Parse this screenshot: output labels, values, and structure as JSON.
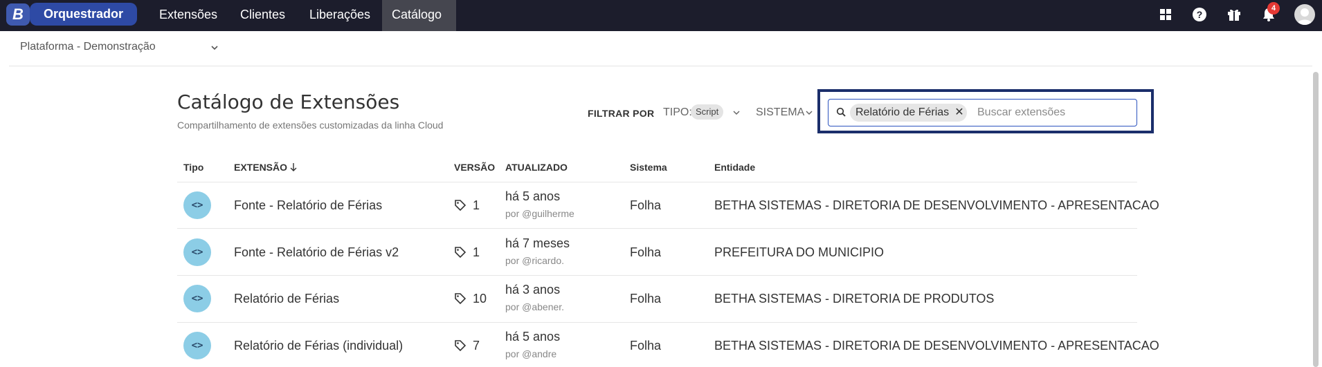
{
  "topbar": {
    "logo": "B",
    "app_name": "Orquestrador",
    "nav": [
      "Extensões",
      "Clientes",
      "Liberações",
      "Catálogo"
    ],
    "active_nav": "Catálogo",
    "notification_count": "4",
    "icons": [
      "apps-grid-icon",
      "help-icon",
      "gift-icon",
      "bell-icon",
      "avatar"
    ]
  },
  "platform": {
    "label": "Plataforma - Demonstração"
  },
  "header": {
    "title": "Catálogo de Extensões",
    "subtitle": "Compartilhamento de extensões customizadas da linha Cloud"
  },
  "filters": {
    "label": "FILTRAR POR",
    "tipo_label": "TIPO:",
    "tipo_value": "Script",
    "sistema_label": "SISTEMA",
    "search_chip": "Relatório de Férias",
    "search_placeholder": "Buscar extensões"
  },
  "table": {
    "columns": [
      "Tipo",
      "EXTENSÃO",
      "VERSÃO",
      "ATUALIZADO",
      "Sistema",
      "Entidade"
    ],
    "rows": [
      {
        "type_icon": "code-icon",
        "extension": "Fonte - Relatório de Férias",
        "version": "1",
        "updated": "há 5 anos",
        "by": "por @guilherme",
        "system": "Folha",
        "entity": "BETHA SISTEMAS - DIRETORIA DE DESENVOLVIMENTO - APRESENTACAO"
      },
      {
        "type_icon": "code-icon",
        "extension": "Fonte - Relatório de Férias v2",
        "version": "1",
        "updated": "há 7 meses",
        "by": "por @ricardo.",
        "system": "Folha",
        "entity": "PREFEITURA DO MUNICIPIO"
      },
      {
        "type_icon": "code-icon",
        "extension": "Relatório de Férias",
        "version": "10",
        "updated": "há 3 anos",
        "by": "por @abener.",
        "system": "Folha",
        "entity": "BETHA SISTEMAS - DIRETORIA DE PRODUTOS"
      },
      {
        "type_icon": "code-icon",
        "extension": "Relatório de Férias (individual)",
        "version": "7",
        "updated": "há 5 anos",
        "by": "por @andre",
        "system": "Folha",
        "entity": "BETHA SISTEMAS - DIRETORIA DE DESENVOLVIMENTO - APRESENTACAO"
      }
    ]
  },
  "colors": {
    "topbar": "#1c1d2c",
    "brand": "#2e4aa5",
    "type_circle": "#8ccde6",
    "highlight": "#1b2e6b"
  }
}
